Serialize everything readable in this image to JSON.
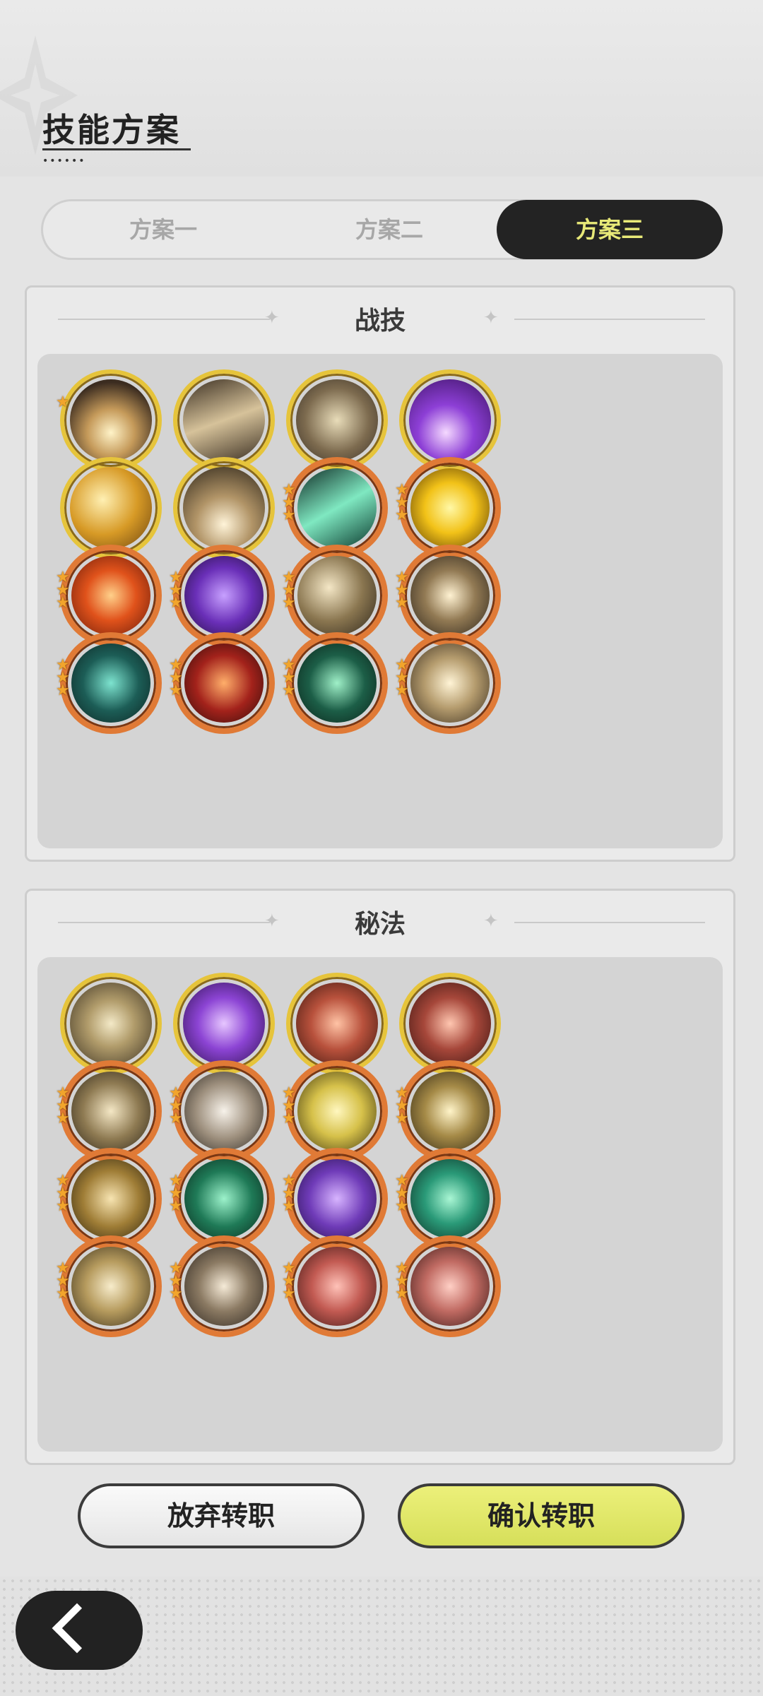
{
  "header": {
    "title": "技能方案"
  },
  "tabs": [
    {
      "label": "方案一",
      "selected": false
    },
    {
      "label": "方案二",
      "selected": false
    },
    {
      "label": "方案三",
      "selected": true
    }
  ],
  "sections": [
    {
      "title": "战技",
      "skills": [
        {
          "icon": "explosion-skill-icon",
          "tier": "gold"
        },
        {
          "icon": "slash-skill-icon",
          "tier": "gold"
        },
        {
          "icon": "whirl-skill-icon",
          "tier": "gold"
        },
        {
          "icon": "purple-orb-skill-icon",
          "tier": "gold"
        },
        {
          "icon": "golden-swirl-skill-icon",
          "tier": "gold"
        },
        {
          "icon": "spike-skill-icon",
          "tier": "gold"
        },
        {
          "icon": "green-dash-skill-icon",
          "tier": "orange"
        },
        {
          "icon": "golden-shield-skill-icon",
          "tier": "orange"
        },
        {
          "icon": "fire-rune-skill-icon",
          "tier": "orange"
        },
        {
          "icon": "purple-claw-skill-icon",
          "tier": "orange"
        },
        {
          "icon": "moon-strike-skill-icon",
          "tier": "orange"
        },
        {
          "icon": "leap-attack-skill-icon",
          "tier": "orange"
        },
        {
          "icon": "teal-web-skill-icon",
          "tier": "orange"
        },
        {
          "icon": "red-slash-skill-icon",
          "tier": "orange"
        },
        {
          "icon": "green-sword-skill-icon",
          "tier": "orange"
        },
        {
          "icon": "golden-blade-skill-icon",
          "tier": "orange"
        }
      ]
    },
    {
      "title": "秘法",
      "skills": [
        {
          "icon": "eye-arcane-icon",
          "tier": "gold"
        },
        {
          "icon": "purple-sigil-arcane-icon",
          "tier": "gold"
        },
        {
          "icon": "red-armor-arcane-icon",
          "tier": "gold"
        },
        {
          "icon": "red-gem-arcane-icon",
          "tier": "gold"
        },
        {
          "icon": "golem-arcane-icon",
          "tier": "orange"
        },
        {
          "icon": "sword-pillar-arcane-icon",
          "tier": "orange"
        },
        {
          "icon": "spirit-arcane-icon",
          "tier": "orange"
        },
        {
          "icon": "vortex-arcane-icon",
          "tier": "orange"
        },
        {
          "icon": "gold-armor-arcane-icon",
          "tier": "orange"
        },
        {
          "icon": "heart-heal-arcane-icon",
          "tier": "orange"
        },
        {
          "icon": "purple-beast-arcane-icon",
          "tier": "orange"
        },
        {
          "icon": "green-blade-arcane-icon",
          "tier": "orange"
        },
        {
          "icon": "moon-heal-arcane-icon",
          "tier": "orange"
        },
        {
          "icon": "flame-arcane-icon",
          "tier": "orange"
        },
        {
          "icon": "red-strike-arcane-icon",
          "tier": "orange"
        },
        {
          "icon": "red-beast-arcane-icon",
          "tier": "orange"
        }
      ]
    }
  ],
  "buttons": {
    "abandon": "放弃转职",
    "confirm": "确认转职"
  },
  "colors": {
    "accent": "#e8e978",
    "gold_ring": "#e6c43b",
    "orange_ring": "#e07a36"
  }
}
